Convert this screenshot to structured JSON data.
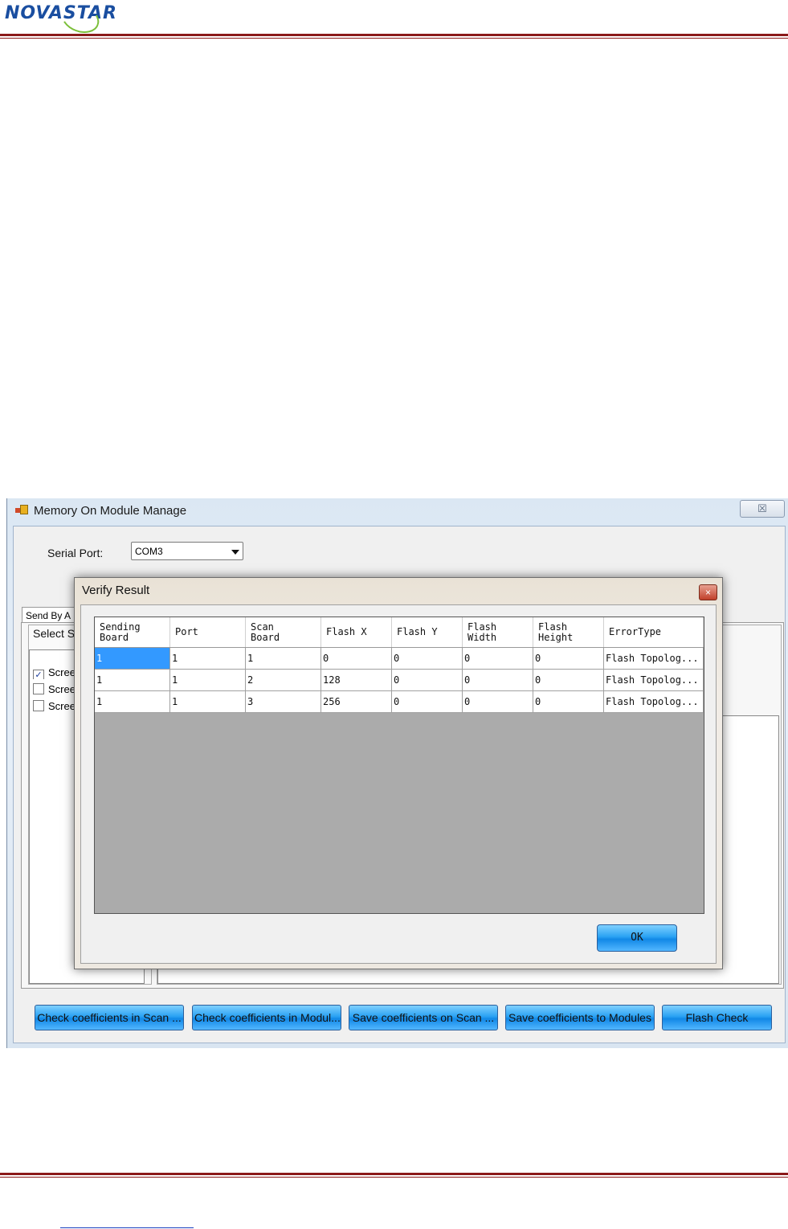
{
  "document": {
    "logo_text": "NOVASTAR"
  },
  "window": {
    "title": "Memory On Module Manage",
    "close_glyph": "☒",
    "serial_port_label": "Serial Port:",
    "serial_port_value": "COM3",
    "tab_label": "Send By A",
    "select_group_label": "Select S",
    "screens": [
      {
        "label": "Screen",
        "checked": true
      },
      {
        "label": "Screen",
        "checked": false
      },
      {
        "label": "Screen",
        "checked": false
      }
    ],
    "buttons": [
      "Check coefficients in Scan ...",
      "Check coefficients in Modul...",
      "Save coefficients on Scan ...",
      "Save coefficients to Modules",
      "Flash Check"
    ]
  },
  "dialog": {
    "title": "Verify Result",
    "close_glyph": "×",
    "columns": [
      [
        "Sending",
        "Board"
      ],
      [
        "Port"
      ],
      [
        "Scan",
        "Board"
      ],
      [
        "Flash X"
      ],
      [
        "Flash Y"
      ],
      [
        "Flash",
        "Width"
      ],
      [
        "Flash",
        "Height"
      ],
      [
        "ErrorType"
      ]
    ],
    "rows": [
      [
        "1",
        "1",
        "1",
        "0",
        "0",
        "0",
        "0",
        "Flash Topolog..."
      ],
      [
        "1",
        "1",
        "2",
        "128",
        "0",
        "0",
        "0",
        "Flash Topolog..."
      ],
      [
        "1",
        "1",
        "3",
        "256",
        "0",
        "0",
        "0",
        "Flash Topolog..."
      ]
    ],
    "ok_label": "OK"
  }
}
